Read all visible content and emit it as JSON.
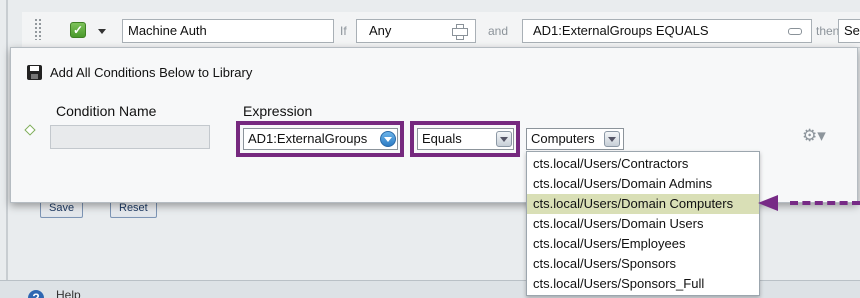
{
  "rule_row": {
    "profile_name": "Machine Auth",
    "if_label": "If",
    "if_value": "Any",
    "and_label": "and",
    "condition_value": "AD1:ExternalGroups EQUALS",
    "then_label": "then",
    "then_value": "Sel"
  },
  "panel": {
    "add_to_library_label": "Add All Conditions Below to Library",
    "columns": {
      "condition_name": "Condition Name",
      "expression": "Expression"
    },
    "condition_name_value": "",
    "expression_attribute": "AD1:ExternalGroups",
    "operator": "Equals",
    "value": "Computers"
  },
  "dropdown": {
    "items": [
      "cts.local/Users/Contractors",
      "cts.local/Users/Domain Admins",
      "cts.local/Users/Domain Computers",
      "cts.local/Users/Domain Users",
      "cts.local/Users/Employees",
      "cts.local/Users/Sponsors",
      "cts.local/Users/Sponsors_Full"
    ],
    "selected_index": 2
  },
  "buttons": {
    "save": "Save",
    "reset": "Reset"
  },
  "footer": {
    "help": "Help"
  },
  "colors": {
    "highlight": "#76297f",
    "selected_row": "#d9dfb6"
  },
  "icons": [
    "grip-icon",
    "checkbox-checked-icon",
    "plus-icon",
    "minus-icon",
    "save-to-library-icon",
    "diamond-icon",
    "gear-icon",
    "help-icon",
    "arrow-icon"
  ]
}
